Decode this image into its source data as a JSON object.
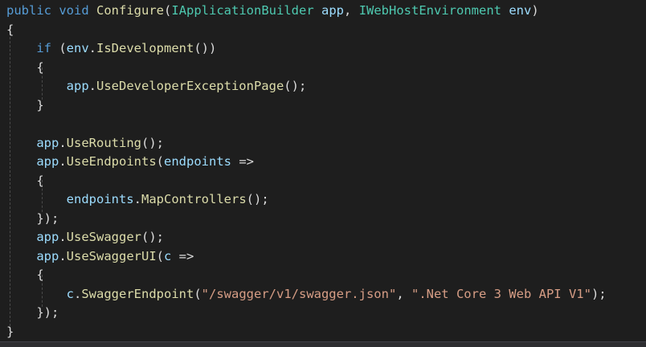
{
  "code": {
    "l1": {
      "kw1": "public",
      "kw2": "void",
      "method": "Configure",
      "p1": "(",
      "type1": "IApplicationBuilder",
      "arg1": "app",
      "sep": ", ",
      "type2": "IWebHostEnvironment",
      "arg2": "env",
      "p2": ")"
    },
    "l2": {
      "brace": "{"
    },
    "l3": {
      "kw": "if",
      "p1": " (",
      "obj": "env",
      "dot": ".",
      "method": "IsDevelopment",
      "p2": "())"
    },
    "l4": {
      "brace": "{"
    },
    "l5": {
      "obj": "app",
      "dot": ".",
      "method": "UseDeveloperExceptionPage",
      "p": "();"
    },
    "l6": {
      "brace": "}"
    },
    "l8": {
      "obj": "app",
      "dot": ".",
      "method": "UseRouting",
      "p": "();"
    },
    "l9": {
      "obj": "app",
      "dot": ".",
      "method": "UseEndpoints",
      "p1": "(",
      "param": "endpoints",
      "arrow": " =>"
    },
    "l10": {
      "brace": "{"
    },
    "l11": {
      "obj": "endpoints",
      "dot": ".",
      "method": "MapControllers",
      "p": "();"
    },
    "l12": {
      "close": "});"
    },
    "l13": {
      "obj": "app",
      "dot": ".",
      "method": "UseSwagger",
      "p": "();"
    },
    "l14": {
      "obj": "app",
      "dot": ".",
      "method": "UseSwaggerUI",
      "p1": "(",
      "param": "c",
      "arrow": " =>"
    },
    "l15": {
      "brace": "{"
    },
    "l16": {
      "obj": "c",
      "dot": ".",
      "method": "SwaggerEndpoint",
      "p1": "(",
      "str1": "\"/swagger/v1/swagger.json\"",
      "sep": ", ",
      "str2": "\".Net Core 3 Web API V1\"",
      "p2": ");"
    },
    "l17": {
      "close": "});"
    },
    "l18": {
      "brace": "}"
    }
  },
  "colors": {
    "background": "#1e1e1e",
    "keyword": "#569cd6",
    "type": "#4ec9b0",
    "method": "#dcdcaa",
    "variable": "#9cdcfe",
    "string": "#d69d85",
    "plain": "#dcdcdc"
  }
}
